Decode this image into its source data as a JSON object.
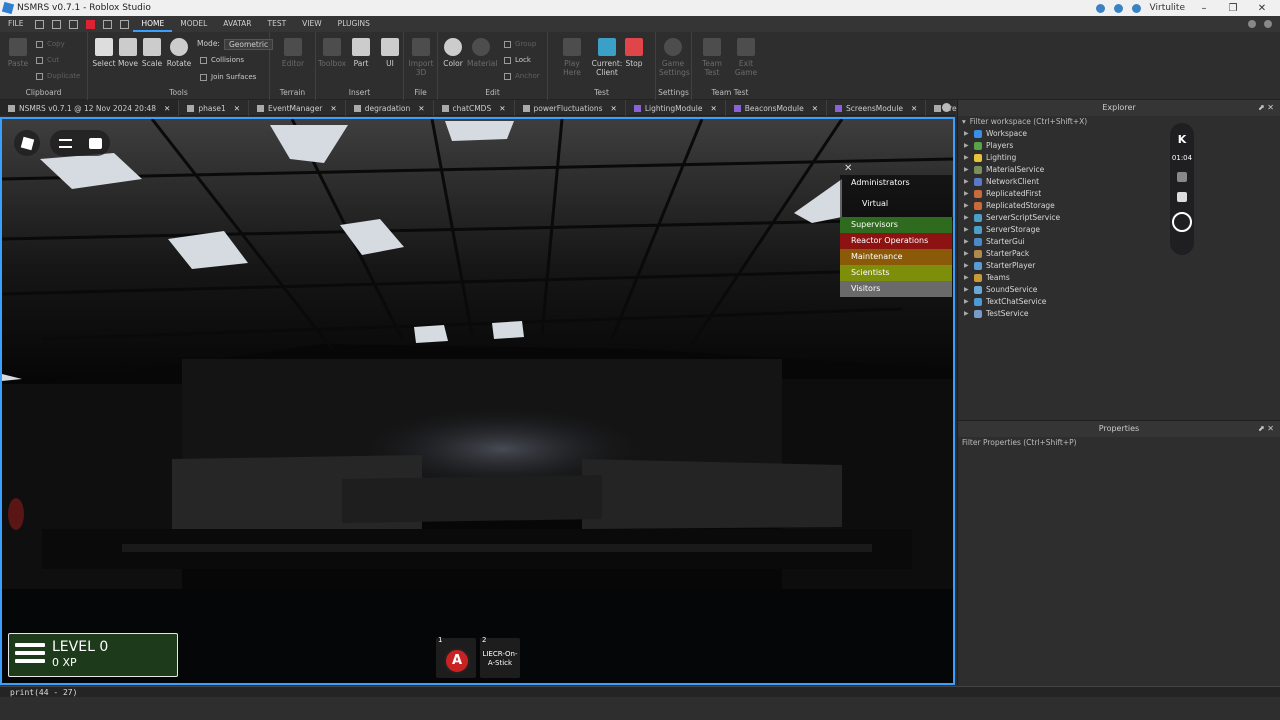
{
  "window": {
    "title": "NSMRS v0.7.1 - Roblox Studio",
    "user": "Virtulite"
  },
  "menu": {
    "file": "FILE",
    "tabs": [
      "HOME",
      "MODEL",
      "AVATAR",
      "TEST",
      "VIEW",
      "PLUGINS"
    ],
    "active": "HOME"
  },
  "ribbon": {
    "clipboard": {
      "label": "Clipboard",
      "paste": "Paste",
      "copy": "Copy",
      "cut": "Cut",
      "duplicate": "Duplicate"
    },
    "tools": {
      "label": "Tools",
      "select": "Select",
      "move": "Move",
      "scale": "Scale",
      "rotate": "Rotate",
      "mode_label": "Mode:",
      "mode_value": "Geometric",
      "collisions": "Collisions",
      "join_surfaces": "Join Surfaces"
    },
    "terrain": {
      "label": "Terrain",
      "editor": "Editor"
    },
    "insert": {
      "label": "Insert",
      "toolbox": "Toolbox",
      "part": "Part",
      "ui": "UI"
    },
    "file": {
      "label": "File",
      "import3d": "Import 3D"
    },
    "edit": {
      "label": "Edit",
      "color": "Color",
      "material": "Material",
      "group": "Group",
      "lock": "Lock",
      "anchor": "Anchor"
    },
    "test": {
      "label": "Test",
      "play_here": "Play Here",
      "current_client": "Current: Client",
      "stop": "Stop"
    },
    "settings": {
      "label": "Settings",
      "game_settings": "Game Settings"
    },
    "team_test": {
      "label": "Team Test",
      "team_test": "Team Test",
      "exit_game": "Exit Game"
    }
  },
  "doc_tabs": [
    {
      "label": "NSMRS v0.7.1 @ 12 Nov 2024 20:48",
      "purple": false
    },
    {
      "label": "phase1",
      "purple": false
    },
    {
      "label": "EventManager",
      "purple": false
    },
    {
      "label": "degradation",
      "purple": false
    },
    {
      "label": "chatCMDS",
      "purple": false
    },
    {
      "label": "powerFluctuations",
      "purple": false
    },
    {
      "label": "LightingModule",
      "purple": true
    },
    {
      "label": "BeaconsModule",
      "purple": true
    },
    {
      "label": "ScreensModule",
      "purple": true
    },
    {
      "label": "Freeco",
      "purple": false
    }
  ],
  "teams": {
    "header": "Administrators",
    "sub": "Virtual",
    "list": [
      {
        "label": "Supervisors",
        "color": "#2e6b1f"
      },
      {
        "label": "Reactor Operations",
        "color": "#8d1313"
      },
      {
        "label": "Maintenance",
        "color": "#8a5a08"
      },
      {
        "label": "Scientists",
        "color": "#7d8e0a"
      },
      {
        "label": "Visitors",
        "color": "#6a6a6a"
      }
    ]
  },
  "hud": {
    "level": "LEVEL 0",
    "xp": "0 XP",
    "slot1_num": "1",
    "slot1_letter": "A",
    "slot2_num": "2",
    "slot2_label": "LIECR-On-A-Stick"
  },
  "explorer": {
    "title": "Explorer",
    "filter": "Filter workspace (Ctrl+Shift+X)",
    "items": [
      {
        "label": "Workspace",
        "color": "#3a8ee6"
      },
      {
        "label": "Players",
        "color": "#5aa24a"
      },
      {
        "label": "Lighting",
        "color": "#e6c33a"
      },
      {
        "label": "MaterialService",
        "color": "#7a8f5a"
      },
      {
        "label": "NetworkClient",
        "color": "#5a7ac8"
      },
      {
        "label": "ReplicatedFirst",
        "color": "#c86a3a"
      },
      {
        "label": "ReplicatedStorage",
        "color": "#c86a3a"
      },
      {
        "label": "ServerScriptService",
        "color": "#4aa0c8"
      },
      {
        "label": "ServerStorage",
        "color": "#4aa0c8"
      },
      {
        "label": "StarterGui",
        "color": "#4a8ac8"
      },
      {
        "label": "StarterPack",
        "color": "#b08a4a"
      },
      {
        "label": "StarterPlayer",
        "color": "#5a9ad8"
      },
      {
        "label": "Teams",
        "color": "#c89a3a"
      },
      {
        "label": "SoundService",
        "color": "#6aa8d8"
      },
      {
        "label": "TextChatService",
        "color": "#4a9ad8"
      },
      {
        "label": "TestService",
        "color": "#7a9ac8"
      }
    ]
  },
  "properties": {
    "title": "Properties",
    "filter": "Filter Properties (Ctrl+Shift+P)"
  },
  "recorder": {
    "time": "01:04",
    "logo": "K"
  },
  "command_bar": {
    "text": "print(44 - 27)"
  }
}
